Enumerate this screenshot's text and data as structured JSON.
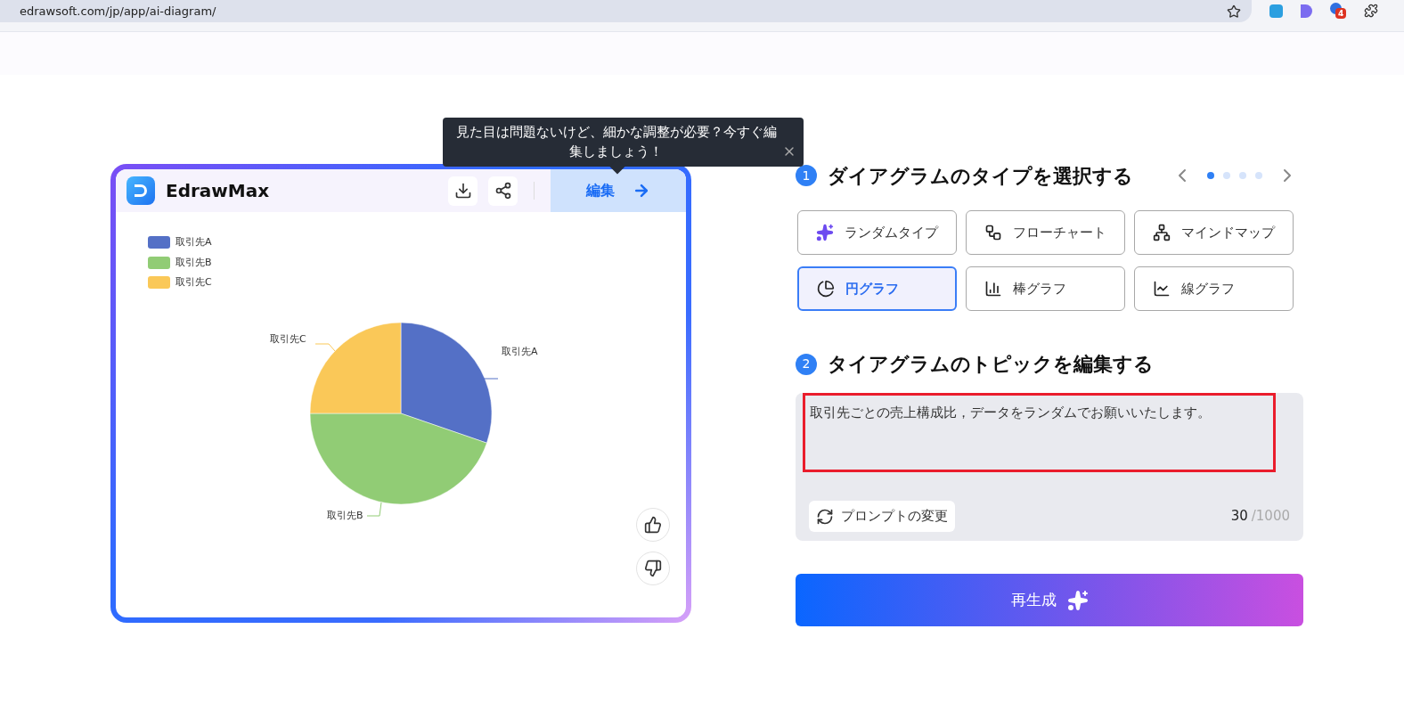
{
  "browser": {
    "url": "edrawsoft.com/jp/app/ai-diagram/",
    "badge": "4"
  },
  "tooltip": {
    "text": "見た目は問題ないけど、細かな調整が必要？今すぐ編集しましょう！"
  },
  "card": {
    "logo_text": "EdrawMax",
    "edit_label": "編集",
    "legend": [
      {
        "label": "取引先A",
        "color": "#5470c6"
      },
      {
        "label": "取引先B",
        "color": "#91cc75"
      },
      {
        "label": "取引先C",
        "color": "#fac858"
      }
    ],
    "slice_labels": [
      "取引先A",
      "取引先B",
      "取引先C"
    ]
  },
  "step1": {
    "number": "1",
    "title": "ダイアグラムのタイプを選択する",
    "pager": [
      {
        "selected": true
      },
      {
        "selected": false
      },
      {
        "selected": false
      },
      {
        "selected": false
      }
    ],
    "types": [
      {
        "kind": "random",
        "label": "ランダムタイプ",
        "selected": false
      },
      {
        "kind": "flow",
        "label": "フローチャート",
        "selected": false
      },
      {
        "kind": "mind",
        "label": "マインドマップ",
        "selected": false
      },
      {
        "kind": "pie",
        "label": "円グラフ",
        "selected": true
      },
      {
        "kind": "bar",
        "label": "棒グラフ",
        "selected": false
      },
      {
        "kind": "line",
        "label": "線グラフ",
        "selected": false
      }
    ]
  },
  "step2": {
    "number": "2",
    "title": "タイアグラムのトピックを編集する",
    "prompt": "取引先ごとの売上構成比，データをランダムでお願いいたします。",
    "change_prompt": "プロンプトの変更",
    "count": "30",
    "limit": "/1000"
  },
  "regenerate": {
    "label": "再生成"
  }
}
